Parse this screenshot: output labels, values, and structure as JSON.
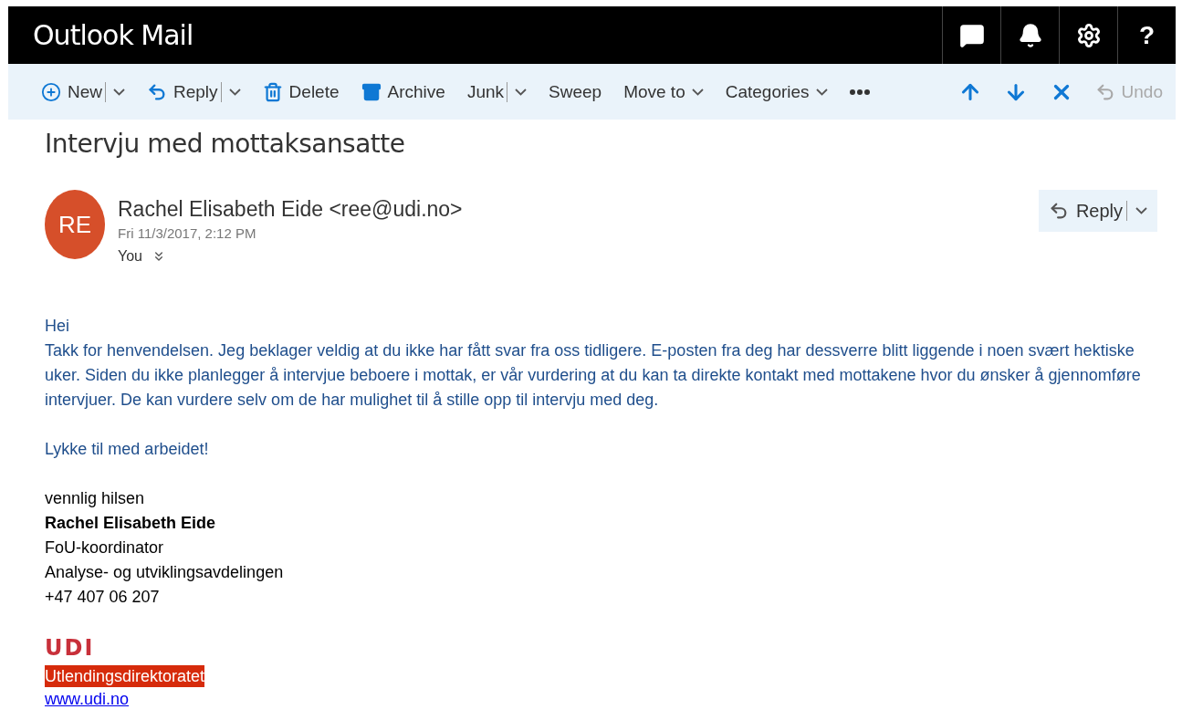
{
  "app": {
    "title": "Outlook Mail",
    "help_label": "?"
  },
  "toolbar": [
    {
      "kind": "split",
      "label": "New"
    },
    {
      "kind": "split",
      "label": "Reply"
    },
    {
      "kind": "plain",
      "label": "Delete"
    },
    {
      "kind": "plain",
      "label": "Archive"
    },
    {
      "kind": "split",
      "label": "Junk"
    },
    {
      "kind": "plain",
      "label": "Sweep"
    },
    {
      "kind": "dropdown",
      "label": "Move to"
    },
    {
      "kind": "dropdown",
      "label": "Categories"
    }
  ],
  "undo": {
    "label": "Undo",
    "disabled": true
  },
  "message": {
    "subject": "Intervju med mottaksansatte",
    "initials": "RE",
    "sender": "Rachel Elisabeth Eide <ree@udi.no>",
    "date": "Fri 11/3/2017, 2:12 PM",
    "to": "You",
    "reply_label": "Reply",
    "body": [
      "Hei\nTakk for henvendelsen. Jeg beklager veldig at du ikke har fått svar fra oss tidligere. E-posten fra deg har dessverre blitt liggende i noen svært hektiske uker. Siden du ikke planlegger å intervjue beboere i mottak, er vår vurdering at du kan ta direkte kontakt med mottakene hvor du ønsker å gjennomføre intervjuer. De kan vurdere selv om de har mulighet til å stille opp til intervju med deg.",
      "Lykke til med arbeidet!"
    ],
    "signature": {
      "greeting": "vennlig hilsen",
      "name": "Rachel Elisabeth Eide",
      "lines": [
        "FoU-koordinator",
        "Analyse- og utviklingsavdelingen",
        "+47 407 06 207"
      ],
      "logo": "UDI",
      "org": "Utlendingsdirektoratet",
      "link": "www.udi.no"
    }
  }
}
